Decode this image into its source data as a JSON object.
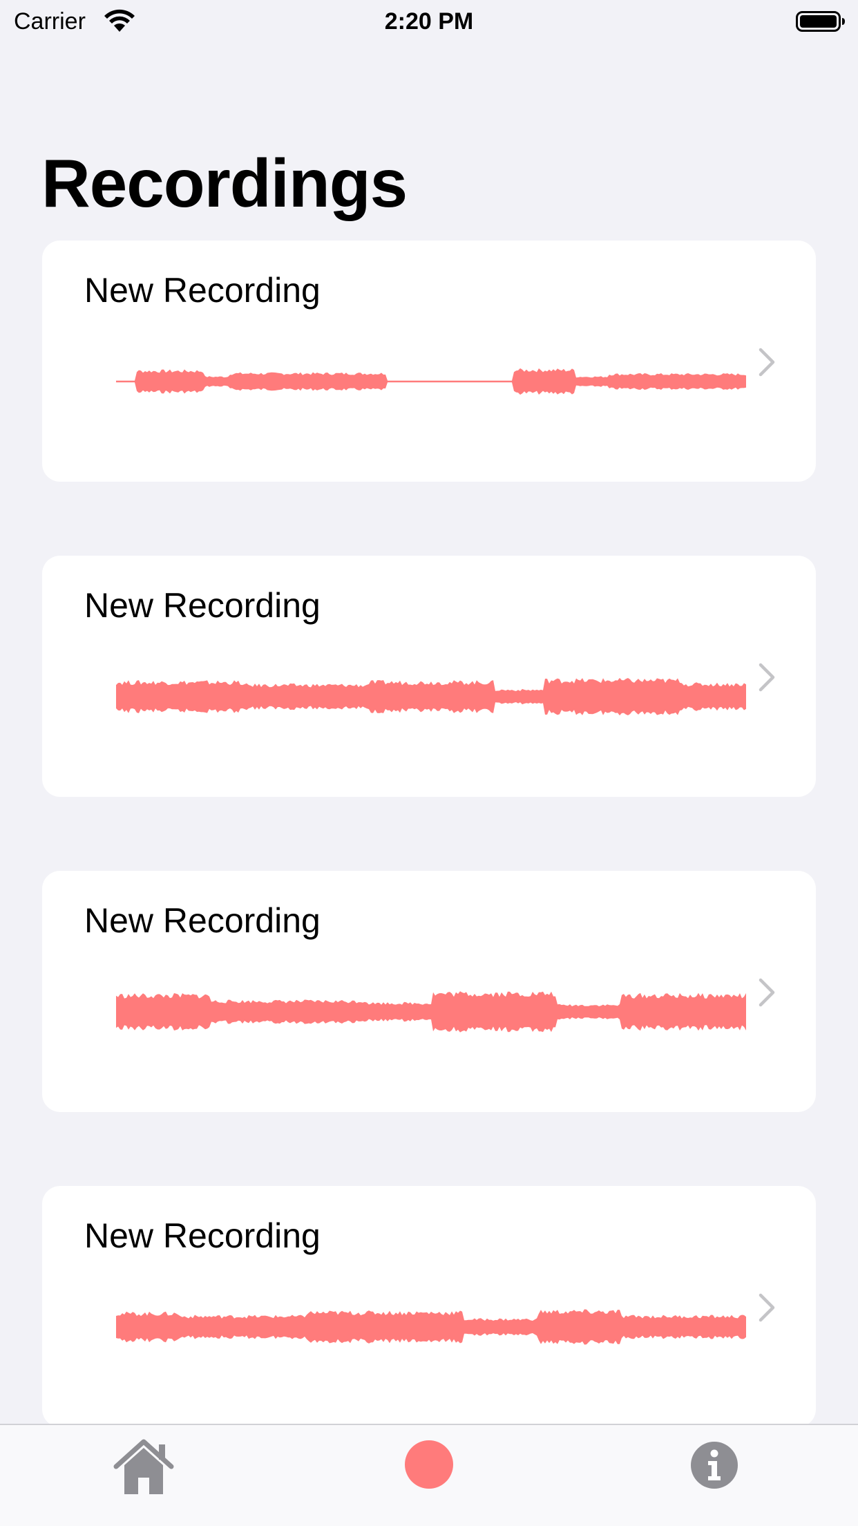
{
  "status_bar": {
    "carrier": "Carrier",
    "time": "2:20 PM",
    "icons": [
      "wifi-icon",
      "battery-icon"
    ]
  },
  "header": {
    "title": "Recordings"
  },
  "recordings": [
    {
      "title": "New Recording"
    },
    {
      "title": "New Recording"
    },
    {
      "title": "New Recording"
    },
    {
      "title": "New Recording"
    }
  ],
  "tab_bar": {
    "items": [
      "home-icon",
      "record-icon",
      "info-icon"
    ]
  },
  "colors": {
    "background": "#f2f2f7",
    "card": "#ffffff",
    "waveform": "#ff7b7b",
    "chevron": "#c4c4c7",
    "tab_icon": "#8e8e93"
  }
}
